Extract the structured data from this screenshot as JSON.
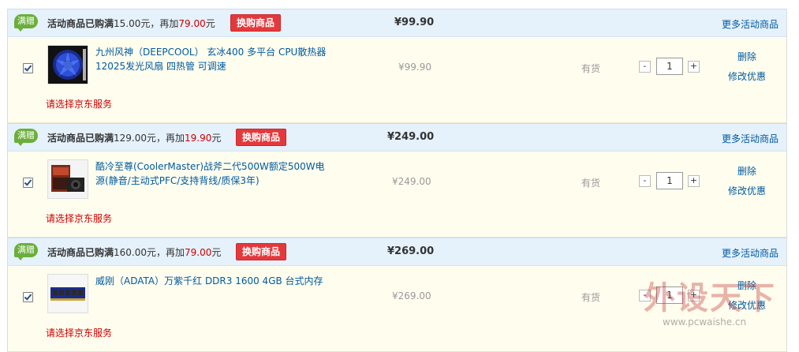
{
  "groups": [
    {
      "tag": "满赠",
      "promo_text": "活动商品已购满",
      "promo_amount": "15.00",
      "promo_unit": "元，再加",
      "promo_add": "79.00",
      "promo_unit2": "元",
      "swap_label": "换购商品",
      "total": "¥99.90",
      "more": "更多活动商品",
      "item": {
        "checked": true,
        "title": "九州风神（DEEPCOOL） 玄冰400 多平台 CPU散热器 12025发光风扇 四热管 可调速",
        "price": "¥99.90",
        "stock": "有货",
        "qty": "1",
        "minus": "-",
        "plus": "+",
        "delete": "删除",
        "edit_promo": "修改优惠",
        "service": "请选择京东服务"
      }
    },
    {
      "tag": "满赠",
      "promo_text": "活动商品已购满",
      "promo_amount": "129.00",
      "promo_unit": "元，再加",
      "promo_add": "19.90",
      "promo_unit2": "元",
      "swap_label": "换购商品",
      "total": "¥249.00",
      "more": "更多活动商品",
      "item": {
        "checked": true,
        "title": "酷冷至尊(CoolerMaster)战斧二代500W额定500W电源(静音/主动式PFC/支持背线/质保3年)",
        "price": "¥249.00",
        "stock": "有货",
        "qty": "1",
        "minus": "-",
        "plus": "+",
        "delete": "删除",
        "edit_promo": "修改优惠",
        "service": "请选择京东服务"
      }
    },
    {
      "tag": "满赠",
      "promo_text": "活动商品已购满",
      "promo_amount": "160.00",
      "promo_unit": "元，再加",
      "promo_add": "79.00",
      "promo_unit2": "元",
      "swap_label": "换购商品",
      "total": "¥269.00",
      "more": "更多活动商品",
      "item": {
        "checked": true,
        "title": "威刚（ADATA）万紫千红 DDR3 1600 4GB 台式内存",
        "price": "¥269.00",
        "stock": "有货",
        "qty": "1",
        "minus": "-",
        "plus": "+",
        "delete": "删除",
        "edit_promo": "修改优惠",
        "service": "请选择京东服务"
      }
    }
  ],
  "watermark": {
    "text": "外设天下",
    "url": "www.pcwaishe.cn"
  },
  "colors": {
    "link": "#005aa0",
    "accent_red": "#e4393c",
    "tag_green": "#6aaf3a",
    "header_bg": "#e5f1fb",
    "row_bg": "#fffdee"
  }
}
